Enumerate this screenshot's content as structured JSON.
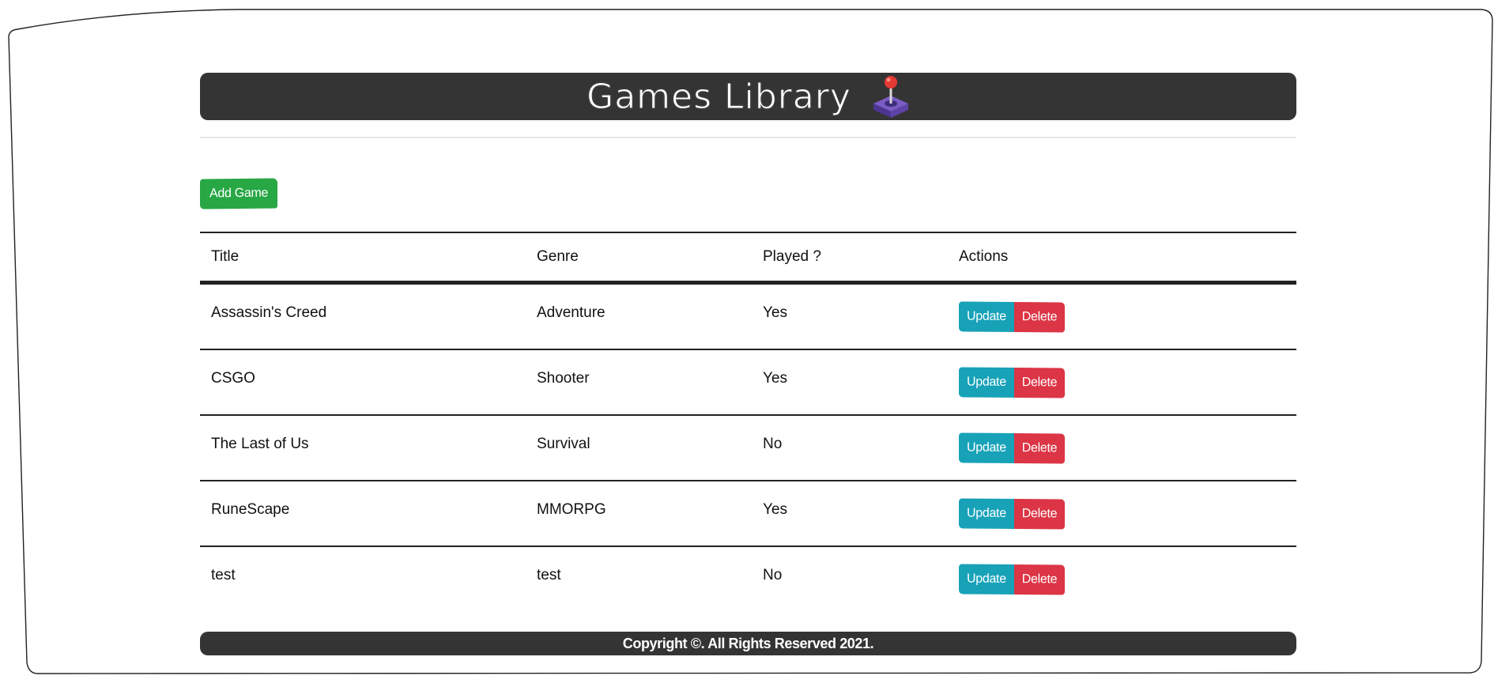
{
  "header": {
    "title": "Games Library"
  },
  "toolbar": {
    "add_label": "Add Game"
  },
  "table": {
    "columns": [
      "Title",
      "Genre",
      "Played ?",
      "Actions"
    ],
    "rows": [
      {
        "title": "Assassin's Creed",
        "genre": "Adventure",
        "played": "Yes"
      },
      {
        "title": "CSGO",
        "genre": "Shooter",
        "played": "Yes"
      },
      {
        "title": "The Last of Us",
        "genre": "Survival",
        "played": "No"
      },
      {
        "title": "RuneScape",
        "genre": "MMORPG",
        "played": "Yes"
      },
      {
        "title": "test",
        "genre": "test",
        "played": "No"
      }
    ],
    "update_label": "Update",
    "delete_label": "Delete"
  },
  "footer": {
    "text": "Copyright ©. All Rights Reserved 2021."
  },
  "colors": {
    "bar": "#343434",
    "add": "#28a745",
    "update": "#17a2b8",
    "delete": "#dc3545"
  },
  "icons": {
    "header_icon": "joystick-icon"
  }
}
